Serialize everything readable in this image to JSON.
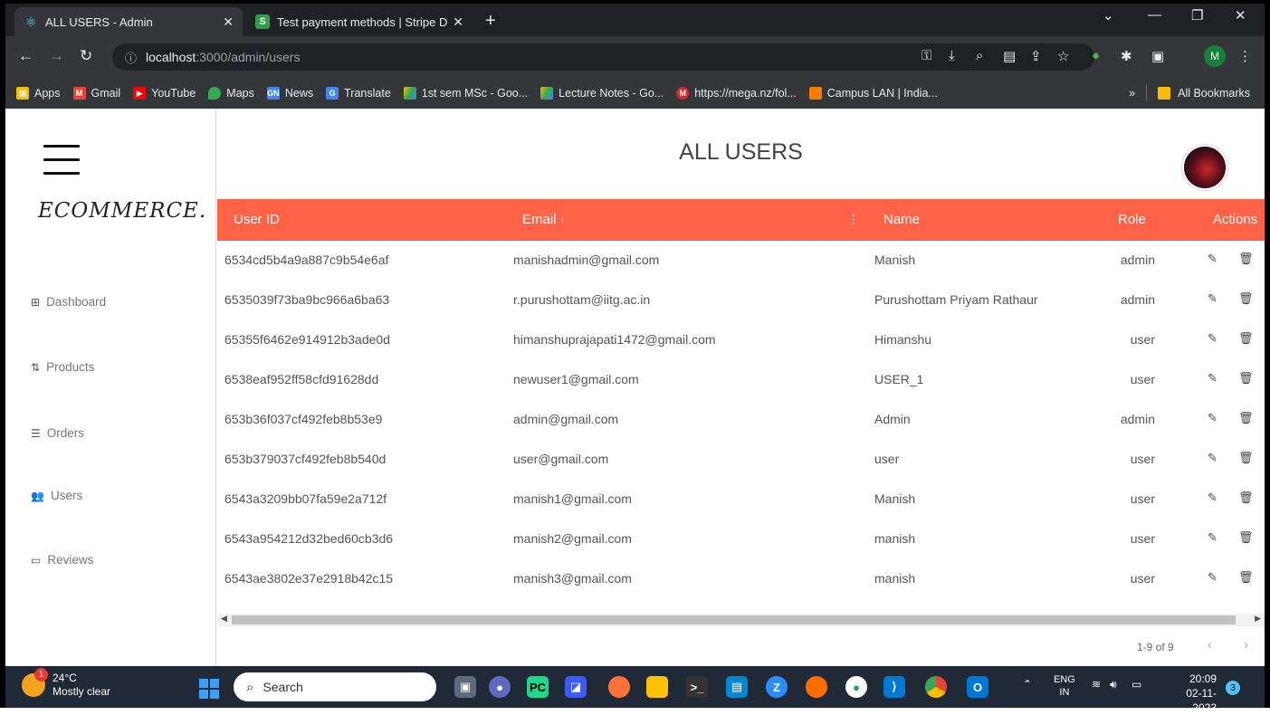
{
  "browser": {
    "tabs": [
      {
        "label": "ALL USERS - Admin"
      },
      {
        "label": "Test payment methods | Stripe D",
        "favicon": "S"
      }
    ],
    "address": {
      "host": "localhost",
      "path": ":3000/admin/users"
    },
    "profile_initial": "M",
    "bookmarks": [
      {
        "label": "Apps",
        "color": "#fbbc04"
      },
      {
        "label": "Gmail",
        "color": "#ea4335",
        "glyph": "M"
      },
      {
        "label": "YouTube",
        "color": "#ff0000",
        "glyph": "▶"
      },
      {
        "label": "Maps",
        "color": "#34a853"
      },
      {
        "label": "News",
        "color": "#4285f4",
        "glyph": "GN"
      },
      {
        "label": "Translate",
        "color": "#4285f4",
        "glyph": "G"
      },
      {
        "label": "1st sem MSc - Goo...",
        "color": "#0f9d58"
      },
      {
        "label": "Lecture Notes - Go...",
        "color": "#0f9d58"
      },
      {
        "label": "https://mega.nz/fol...",
        "color": "#d9272e",
        "glyph": "M"
      },
      {
        "label": "Campus LAN | India...",
        "color": "#f57c00"
      }
    ],
    "all_bookmarks": "All Bookmarks",
    "more": "»"
  },
  "sidebar": {
    "logo": "ECOMMERCE.",
    "items": [
      {
        "label": "Dashboard",
        "icon": "⊞"
      },
      {
        "label": "Products",
        "icon": "⇅"
      },
      {
        "label": "Orders",
        "icon": "☰"
      },
      {
        "label": "Users",
        "icon": "👥"
      },
      {
        "label": "Reviews",
        "icon": "▭"
      }
    ]
  },
  "main": {
    "title": "ALL USERS",
    "columns": {
      "id": "User ID",
      "email": "Email",
      "sort": "↑",
      "name": "Name",
      "role": "Role",
      "actions": "Actions"
    },
    "rows": [
      {
        "id": "6534cd5b4a9a887c9b54e6af",
        "email": "manishadmin@gmail.com",
        "name": "Manish",
        "role": "admin"
      },
      {
        "id": "6535039f73ba9bc966a6ba63",
        "email": "r.purushottam@iitg.ac.in",
        "name": "Purushottam Priyam Rathaur",
        "role": "admin"
      },
      {
        "id": "65355f6462e914912b3ade0d",
        "email": "himanshuprajapati1472@gmail.com",
        "name": "Himanshu",
        "role": "user"
      },
      {
        "id": "6538eaf952ff58cfd91628dd",
        "email": "newuser1@gmail.com",
        "name": "USER_1",
        "role": "user"
      },
      {
        "id": "653b36f037cf492feb8b53e9",
        "email": "admin@gmail.com",
        "name": "Admin",
        "role": "admin"
      },
      {
        "id": "653b379037cf492feb8b540d",
        "email": "user@gmail.com",
        "name": "user",
        "role": "user"
      },
      {
        "id": "6543a3209bb07fa59e2a712f",
        "email": "manish1@gmail.com",
        "name": "Manish",
        "role": "user"
      },
      {
        "id": "6543a954212d32bed60cb3d6",
        "email": "manish2@gmail.com",
        "name": "manish",
        "role": "user"
      },
      {
        "id": "6543ae3802e37e2918b42c15",
        "email": "manish3@gmail.com",
        "name": "manish",
        "role": "user"
      }
    ],
    "pagination": "1-9 of 9"
  },
  "taskbar": {
    "temp": "24°C",
    "weather": "Mostly clear",
    "weather_badge": "1",
    "search_placeholder": "Search",
    "lang": "ENG",
    "region": "IN",
    "time": "20:09",
    "date": "02-11-2023",
    "notifications": "3"
  },
  "colors": {
    "header": "#ff6347"
  }
}
